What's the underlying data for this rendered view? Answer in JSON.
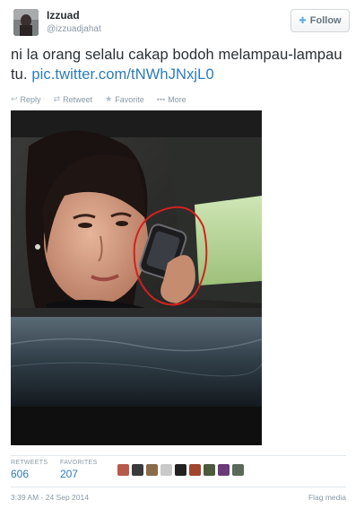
{
  "user": {
    "full_name": "Izzuad",
    "handle": "@izzuadjahat",
    "avatar_icon": "user-avatar"
  },
  "follow_button": {
    "label": "Follow",
    "icon": "add-person-icon"
  },
  "tweet": {
    "text": "ni la orang selalu cakap bodoh melampau-lampau tu.",
    "link": "pic.twitter.com/tNWhJNxjL0"
  },
  "actions": [
    {
      "label": "Reply",
      "icon": "reply-icon"
    },
    {
      "label": "Retweet",
      "icon": "retweet-icon"
    },
    {
      "label": "Favorite",
      "icon": "star-icon"
    },
    {
      "label": "More",
      "icon": "more-dots-icon"
    }
  ],
  "media": {
    "icon": "photo-of-woman-on-phone-in-car-with-red-circle"
  },
  "stats": {
    "retweets_label": "RETWEETS",
    "retweets_value": "606",
    "favorites_label": "FAVORITES",
    "favorites_value": "207"
  },
  "favoriter_avatar_colors": [
    "#b85a4a",
    "#3a3a3a",
    "#8a6a4a",
    "#c9c9c9",
    "#222222",
    "#a0452e",
    "#4a5a3a",
    "#6a3a7a",
    "#5a6a5a"
  ],
  "footer": {
    "timestamp": "3:39 AM - 24 Sep 2014",
    "flag_label": "Flag media"
  },
  "colors": {
    "link": "#2b7bb9",
    "muted": "#8899a6",
    "text": "#292f33",
    "annotation_circle": "#d42020"
  }
}
